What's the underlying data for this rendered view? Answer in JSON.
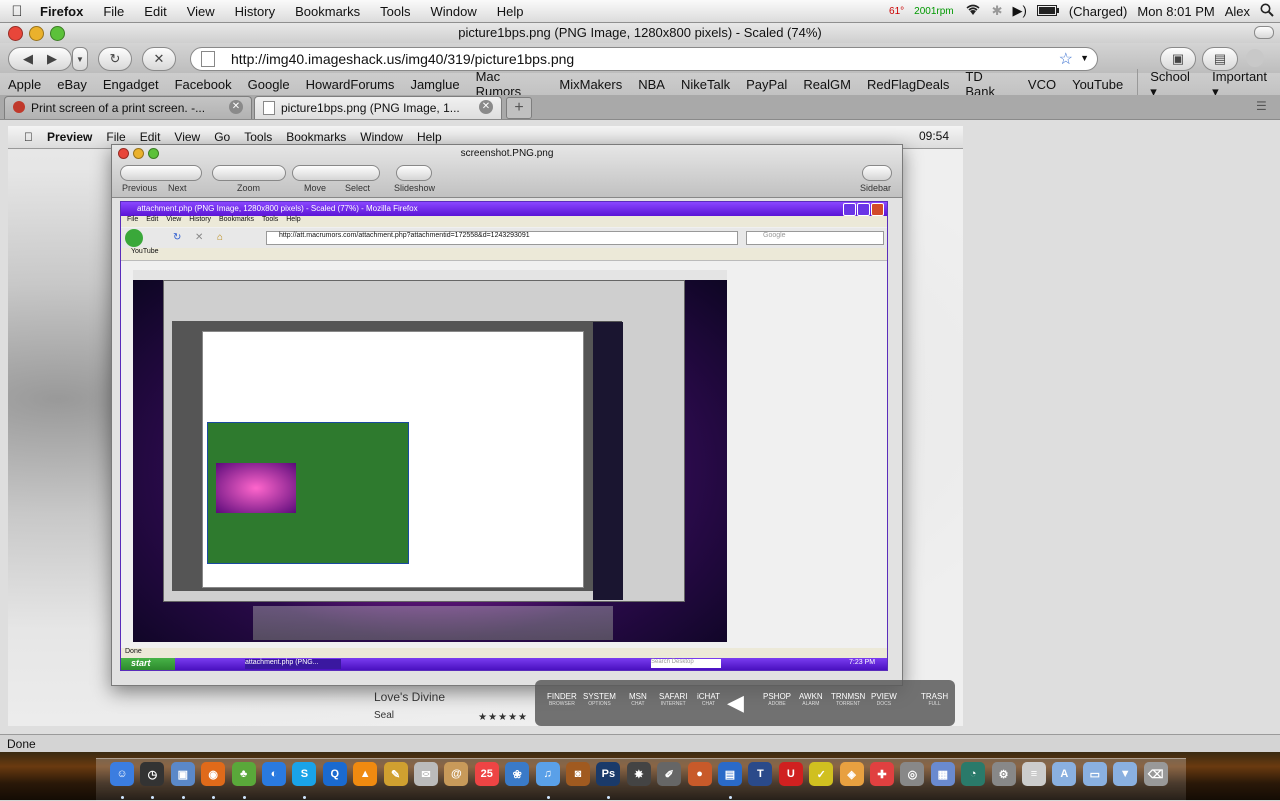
{
  "menubar": {
    "app": "Firefox",
    "items": [
      "File",
      "Edit",
      "View",
      "History",
      "Bookmarks",
      "Tools",
      "Window",
      "Help"
    ],
    "temp": "61°",
    "fan": "2001rpm",
    "battery": "(Charged)",
    "clock": "Mon 8:01 PM",
    "user": "Alex"
  },
  "window": {
    "title": "picture1bps.png (PNG Image, 1280x800 pixels) - Scaled (74%)"
  },
  "nav": {
    "url": "http://img40.imageshack.us/img40/319/picture1bps.png"
  },
  "bookmarks": [
    "Apple",
    "eBay",
    "Engadget",
    "Facebook",
    "Google",
    "HowardForums",
    "Jamglue",
    "Mac Rumors",
    "MixMakers",
    "NBA",
    "NikeTalk",
    "PayPal",
    "RealGM",
    "RedFlagDeals",
    "TD Bank",
    "VCO",
    "YouTube",
    "School ▾",
    "Important ▾"
  ],
  "tabs": [
    {
      "label": "Print screen of a print screen. -..."
    },
    {
      "label": "picture1bps.png (PNG Image, 1..."
    }
  ],
  "screenshot": {
    "menubar": {
      "app": "Preview",
      "items": [
        "File",
        "Edit",
        "View",
        "Go",
        "Tools",
        "Bookmarks",
        "Window",
        "Help"
      ],
      "time": "09:54"
    },
    "preview": {
      "title": "screenshot.PNG.png",
      "toolbar": {
        "previous": "Previous",
        "next": "Next",
        "zoom": "Zoom",
        "move": "Move",
        "select": "Select",
        "slideshow": "Slideshow",
        "sidebar": "Sidebar"
      }
    },
    "firefox_xp": {
      "title": "attachment.php (PNG Image, 1280x800 pixels) - Scaled (77%) - Mozilla Firefox",
      "menu": [
        "File",
        "Edit",
        "View",
        "History",
        "Bookmarks",
        "Tools",
        "Help"
      ],
      "url": "http://att.macrumors.com/attachment.php?attachmentid=172558&d=1243293091",
      "search_placeholder": "Google",
      "bookmark": "YouTube",
      "status": "Done",
      "start": "start",
      "task": "attachment.php (PNG...",
      "task_search": "Search Desktop",
      "clock": "7:23 PM"
    },
    "itunes": {
      "song": "Love's Divine",
      "artist": "Seal",
      "stars": "★★★★★"
    },
    "launcher": [
      {
        "label": "FINDER",
        "sub": "BROWSER"
      },
      {
        "label": "SYSTEM",
        "sub": "OPTIONS"
      },
      {
        "label": "MSN",
        "sub": "CHAT"
      },
      {
        "label": "SAFARI",
        "sub": "INTERNET"
      },
      {
        "label": "iCHAT",
        "sub": "CHAT"
      },
      {
        "label": "PSHOP",
        "sub": "ADOBE"
      },
      {
        "label": "AWKN",
        "sub": "ALARM"
      },
      {
        "label": "TRNMSN",
        "sub": "TORRENT"
      },
      {
        "label": "PVIEW",
        "sub": "DOCS"
      },
      {
        "label": "TRASH",
        "sub": "FULL"
      }
    ]
  },
  "statusbar": {
    "text": "Done"
  },
  "dock": [
    {
      "name": "finder",
      "glyph": "☺",
      "color": "#3b7de0"
    },
    {
      "name": "dashboard",
      "glyph": "◷",
      "color": "#333"
    },
    {
      "name": "preview",
      "glyph": "▣",
      "color": "#5b88c8"
    },
    {
      "name": "firefox",
      "glyph": "◉",
      "color": "#e06a1a"
    },
    {
      "name": "adium",
      "glyph": "♣",
      "color": "#5aa83a"
    },
    {
      "name": "webcam",
      "glyph": "◐",
      "color": "#2a7ae0"
    },
    {
      "name": "skype",
      "glyph": "S",
      "color": "#1aa3e8"
    },
    {
      "name": "quicktime",
      "glyph": "Q",
      "color": "#1a6ad0"
    },
    {
      "name": "vlc",
      "glyph": "▲",
      "color": "#f08a10"
    },
    {
      "name": "stickies",
      "glyph": "✎",
      "color": "#d0a030"
    },
    {
      "name": "textedit",
      "glyph": "✉",
      "color": "#bbb"
    },
    {
      "name": "mail",
      "glyph": "@",
      "color": "#c89a5a"
    },
    {
      "name": "ical",
      "glyph": "25",
      "color": "#e44"
    },
    {
      "name": "iphoto",
      "glyph": "❀",
      "color": "#3a7ac8"
    },
    {
      "name": "itunes",
      "glyph": "♫",
      "color": "#5aa0e8"
    },
    {
      "name": "photo-booth",
      "glyph": "◙",
      "color": "#a05a20"
    },
    {
      "name": "photoshop",
      "glyph": "Ps",
      "color": "#1a3a6a"
    },
    {
      "name": "clapper",
      "glyph": "✸",
      "color": "#444"
    },
    {
      "name": "pencil",
      "glyph": "✐",
      "color": "#666"
    },
    {
      "name": "lamp",
      "glyph": "●",
      "color": "#c85a2a"
    },
    {
      "name": "keynote",
      "glyph": "▤",
      "color": "#2a6ac8"
    },
    {
      "name": "imovie",
      "glyph": "T",
      "color": "#2a4a8a"
    },
    {
      "name": "magnet",
      "glyph": "U",
      "color": "#d02020"
    },
    {
      "name": "tool",
      "glyph": "✓",
      "color": "#d0c020"
    },
    {
      "name": "package",
      "glyph": "◈",
      "color": "#e8a040"
    },
    {
      "name": "utility",
      "glyph": "✚",
      "color": "#e04040"
    },
    {
      "name": "airport",
      "glyph": "◎",
      "color": "#888"
    },
    {
      "name": "dashboard-grid",
      "glyph": "▦",
      "color": "#6a8ad0"
    },
    {
      "name": "time-machine",
      "glyph": "◔",
      "color": "#2a7a6a"
    },
    {
      "name": "utilities",
      "glyph": "⚙",
      "color": "#888"
    },
    {
      "name": "script",
      "glyph": "≡",
      "color": "#ccc"
    },
    {
      "name": "applications",
      "glyph": "A",
      "color": "#8ab0e0"
    },
    {
      "name": "documents",
      "glyph": "▭",
      "color": "#8ab0e0"
    },
    {
      "name": "downloads",
      "glyph": "▼",
      "color": "#8ab0e0"
    },
    {
      "name": "trash",
      "glyph": "⌫",
      "color": "#999"
    }
  ]
}
